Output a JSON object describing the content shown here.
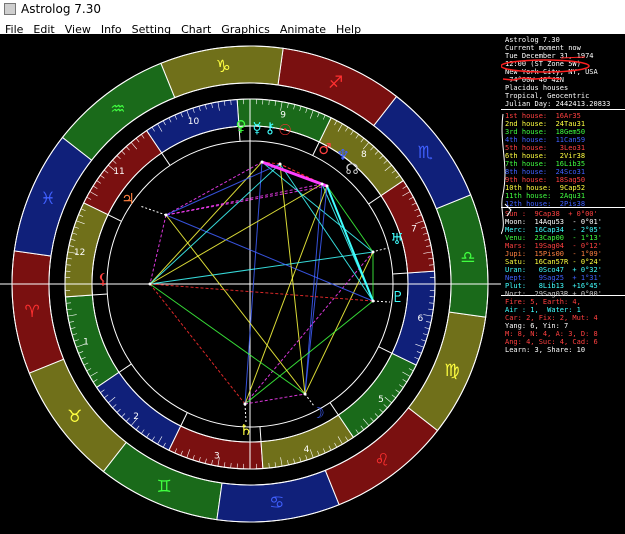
{
  "window": {
    "title": "Astrolog 7.30"
  },
  "menu": [
    "File",
    "Edit",
    "View",
    "Info",
    "Setting",
    "Chart",
    "Graphics",
    "Animate",
    "Help"
  ],
  "colors": {
    "fire": "#ff3030",
    "earth": "#ffff40",
    "air": "#40ffff",
    "water": "#4060ff",
    "zodiac_bg": [
      "#7a1010",
      "#70701a",
      "#1a6a1a",
      "#10207a"
    ]
  },
  "wheel": {
    "signs": [
      "♈",
      "♉",
      "♊",
      "♋",
      "♌",
      "♍",
      "♎",
      "♏",
      "♐",
      "♑",
      "♒",
      "♓"
    ],
    "house_numbers": [
      "1",
      "2",
      "3",
      "4",
      "5",
      "6",
      "7",
      "8",
      "9",
      "10",
      "11",
      "12"
    ],
    "planet_glyphs": {
      "mars": "♂",
      "neptune": "♆",
      "uranus": "♅",
      "pluto": "♇",
      "venus": "♀",
      "mercury": "☿",
      "sun": "☉",
      "saturn": "♄",
      "moon": "☽",
      "jupiter": "♃",
      "node": "☊",
      "lilith": "⚸",
      "chiron": "⚷"
    }
  },
  "info_panel": {
    "header": [
      {
        "text": "Astrolog 7.30",
        "color": "#ffffff"
      },
      {
        "text": "Current moment now",
        "color": "#ffffff"
      },
      {
        "text": "Tue December 31, 1974",
        "color": "#ffffff"
      },
      {
        "text": "12:00 (ST Zone 5W)",
        "color": "#ffffff"
      },
      {
        "text": "New York City, NY, USA",
        "color": "#ffffff"
      },
      {
        "text": " 74°00W 40°42N",
        "color": "#ffffff"
      },
      {
        "text": "Placidus houses",
        "color": "#ffffff"
      },
      {
        "text": "Tropical, Geocentric",
        "color": "#ffffff"
      },
      {
        "text": "Julian Day: 2442413.20833",
        "color": "#ffffff"
      }
    ],
    "houses": [
      {
        "text": "1st house:  16Ar35",
        "color": "#ff4040"
      },
      {
        "text": "2nd house:  24Tau31",
        "color": "#ffff40"
      },
      {
        "text": "3rd house:  18Gem50",
        "color": "#40ff40"
      },
      {
        "text": "4th house:  11Can59",
        "color": "#4060ff"
      },
      {
        "text": "5th house:   3Leo31",
        "color": "#ff4040"
      },
      {
        "text": "6th house:   2Vir38",
        "color": "#ffff40"
      },
      {
        "text": "7th house:  16Lib35",
        "color": "#40ff40"
      },
      {
        "text": "8th house:  24Sco31",
        "color": "#4060ff"
      },
      {
        "text": "9th house:  18Sag50",
        "color": "#ff4040"
      },
      {
        "text": "10th house:  9Cap52",
        "color": "#ffff40"
      },
      {
        "text": "11th house:  2Aqu31",
        "color": "#40ff40"
      },
      {
        "text": "12th house:  2Pis38",
        "color": "#4060ff"
      }
    ],
    "planets": [
      {
        "text": "Sun :  9Cap38  + 0°00'",
        "color": "#ff4040"
      },
      {
        "text": "Moon:  14Aqu53  - 0°01'",
        "color": "#ffffff"
      },
      {
        "text": "Merc:  16Cap34  - 2°05'",
        "color": "#40ffff"
      },
      {
        "text": "Venu:  23Cap00  - 1°13'",
        "color": "#40ff40"
      },
      {
        "text": "Mars:  19Sag04  - 0°12'",
        "color": "#ff4040"
      },
      {
        "text": "Jupi:  15Pis00  - 1°09'",
        "color": "#ff8040"
      },
      {
        "text": "Satu:  16Can57R - 0°24'",
        "color": "#ffff40"
      },
      {
        "text": "Uran:   0Sco47  + 0°32'",
        "color": "#40ffff"
      },
      {
        "text": "Nept:   9Sag25  + 1°31'",
        "color": "#4060ff"
      },
      {
        "text": "Plut:   8Lib13  +16°45'",
        "color": "#40ffff"
      },
      {
        "text": "Nort:  29Sag03R + 0°00'",
        "color": "#c8c8c8"
      }
    ],
    "elements": [
      {
        "text": "Fire: 5, Earth: 4,",
        "color": "#ff4040"
      },
      {
        "text": "Air : 1,  Water: 1",
        "color": "#40ffff"
      },
      {
        "text": "Car: 2, Fix: 2, Mut: 4",
        "color": "#ff4040"
      },
      {
        "text": "Yang: 6, Yin: 7",
        "color": "#ffffff"
      },
      {
        "text": "M: 8, N: 4, A: 3, D: 8",
        "color": "#ff4040"
      },
      {
        "text": "Ang: 4, Suc: 4, Cad: 6",
        "color": "#ff4040"
      },
      {
        "text": "Learn: 3, Share: 10",
        "color": "#ffffff"
      }
    ]
  }
}
